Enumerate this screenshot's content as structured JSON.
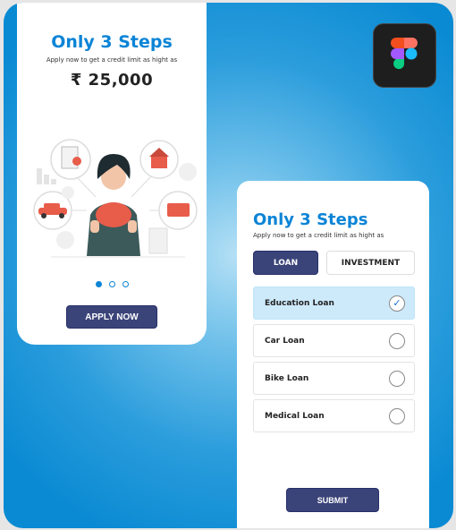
{
  "promo_card": {
    "title": "Only 3 Steps",
    "subtitle": "Apply now to get a  credit limit as hight as",
    "amount": "₹ 25,000",
    "carousel": {
      "total": 3,
      "active": 1
    },
    "apply_label": "APPLY NOW"
  },
  "app_icon": "figma-logo",
  "loan_card": {
    "title": "Only 3 Steps",
    "subtitle": "Apply now to get a  credit limit as hight as",
    "tabs": [
      {
        "label": "LOAN",
        "active": true
      },
      {
        "label": "INVESTMENT",
        "active": false
      }
    ],
    "options": [
      {
        "label": "Education Loan",
        "selected": true
      },
      {
        "label": "Car Loan",
        "selected": false
      },
      {
        "label": "Bike Loan",
        "selected": false
      },
      {
        "label": "Medical Loan",
        "selected": false
      }
    ],
    "check_mark": "✓",
    "submit_label": "SUBMIT"
  },
  "colors": {
    "accent": "#0b84d6",
    "button": "#3b4479",
    "selected": "#cdeafb"
  }
}
